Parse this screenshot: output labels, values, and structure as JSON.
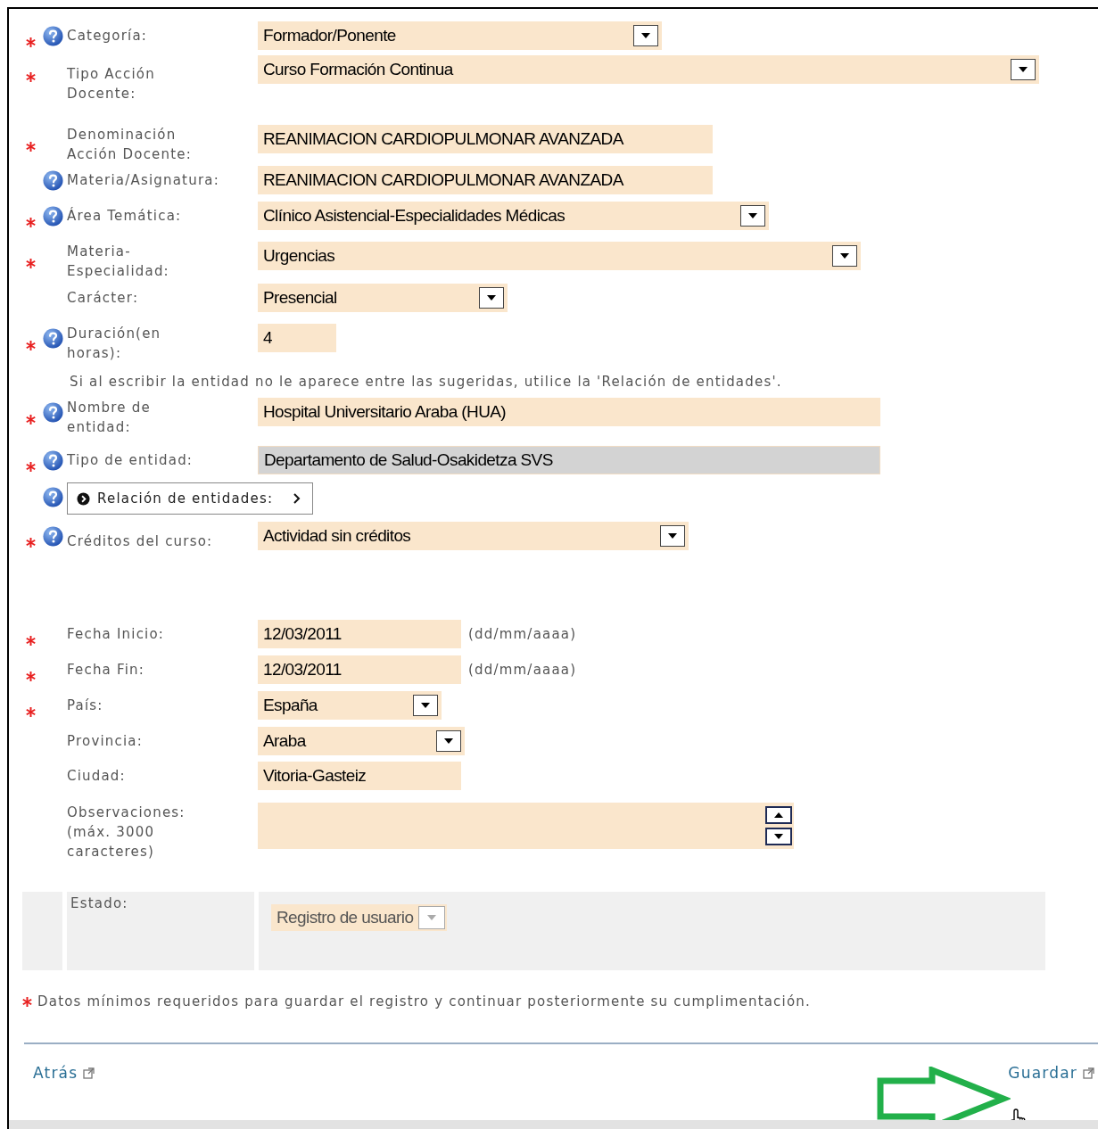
{
  "fields": [
    {
      "kind": "select",
      "required": true,
      "help": true,
      "label": "Categoría:",
      "value": "Formador/Ponente"
    },
    {
      "kind": "select",
      "required": true,
      "help": false,
      "label": "Tipo Acción Docente:",
      "value": "Curso Formación Continua"
    },
    {
      "kind": "input",
      "required": true,
      "help": false,
      "label": "Denominación Acción Docente:",
      "value": "REANIMACION CARDIOPULMONAR AVANZADA"
    },
    {
      "kind": "input",
      "required": false,
      "help": true,
      "label": "Materia/Asignatura:",
      "value": "REANIMACION CARDIOPULMONAR AVANZADA"
    },
    {
      "kind": "select",
      "required": true,
      "help": true,
      "label": "Área Temática:",
      "value": "Clínico Asistencial-Especialidades Médicas"
    },
    {
      "kind": "select",
      "required": true,
      "help": false,
      "label": "Materia-Especialidad:",
      "value": "Urgencias"
    },
    {
      "kind": "select",
      "required": false,
      "help": false,
      "label": "Carácter:",
      "value": "Presencial"
    },
    {
      "kind": "input",
      "required": true,
      "help": true,
      "label": "Duración(en horas):",
      "value": "4"
    },
    {
      "kind": "note",
      "text": "Si al escribir la entidad no le aparece entre las sugeridas, utilice la 'Relación de entidades'."
    },
    {
      "kind": "input",
      "required": true,
      "help": true,
      "label": "Nombre de entidad:",
      "value": "Hospital Universitario Araba (HUA)"
    },
    {
      "kind": "readonly",
      "required": true,
      "help": true,
      "label": "Tipo de entidad:",
      "value": "Departamento de Salud-Osakidetza SVS"
    },
    {
      "kind": "expander",
      "required": false,
      "help": true,
      "label": "Relación de entidades:"
    },
    {
      "kind": "select",
      "required": true,
      "help": true,
      "label": "Créditos del curso:",
      "value": "Actividad sin créditos"
    },
    {
      "kind": "input",
      "required": true,
      "help": false,
      "label": "Fecha Inicio:",
      "value": "12/03/2011",
      "hint": "(dd/mm/aaaa)"
    },
    {
      "kind": "input",
      "required": true,
      "help": false,
      "label": "Fecha Fin:",
      "value": "12/03/2011",
      "hint": "(dd/mm/aaaa)"
    },
    {
      "kind": "select",
      "required": true,
      "help": false,
      "label": "País:",
      "value": "España"
    },
    {
      "kind": "select",
      "required": false,
      "help": false,
      "label": "Provincia:",
      "value": "Araba"
    },
    {
      "kind": "input",
      "required": false,
      "help": false,
      "label": "Ciudad:",
      "value": "Vitoria-Gasteiz"
    },
    {
      "kind": "textarea",
      "required": false,
      "help": false,
      "label": "Observaciones: (máx. 3000 caracteres)"
    }
  ],
  "status": {
    "label": "Estado:",
    "value": "Registro de usuario",
    "disabled": true
  },
  "footnote": "Datos mínimos requeridos para guardar el registro y continuar posteriormente su cumplimentación.",
  "actions": [
    {
      "label": "Atrás"
    },
    {
      "label": "Guardar"
    }
  ]
}
